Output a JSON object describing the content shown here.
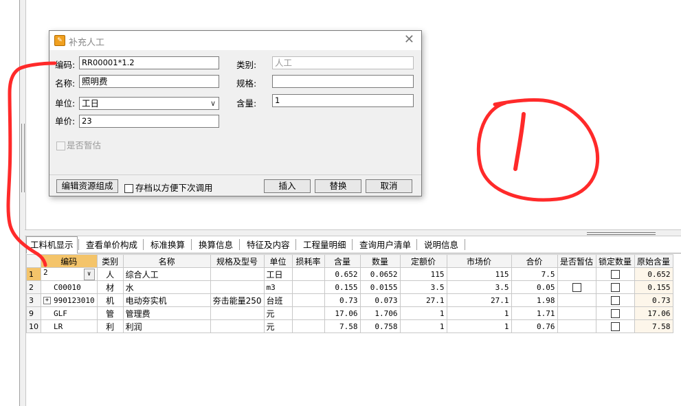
{
  "dialog": {
    "title": "补充人工",
    "icon": "app-icon",
    "close": "✕",
    "code_label": "编码:",
    "code_value": "RR00001*1.2",
    "name_label": "名称:",
    "name_value": "照明费",
    "unit_label": "单位:",
    "unit_value": "工日",
    "price_label": "单价:",
    "price_value": "23",
    "category_label": "类别:",
    "category_value": "人工",
    "spec_label": "规格:",
    "spec_value": "",
    "qty_label": "含量:",
    "qty_value": "1",
    "estimate_label": "是否暂估",
    "edit_button": "编辑资源组成",
    "save_label": "存档以方便下次调用",
    "insert_button": "插入",
    "replace_button": "替换",
    "cancel_button": "取消"
  },
  "tabs": [
    "工料机显示",
    "查看单价构成",
    "标准换算",
    "换算信息",
    "特征及内容",
    "工程量明细",
    "查询用户清单",
    "说明信息"
  ],
  "table": {
    "headers": [
      "编码",
      "类别",
      "名称",
      "规格及型号",
      "单位",
      "损耗率",
      "含量",
      "数量",
      "定额价",
      "市场价",
      "合价",
      "是否暂估",
      "锁定数量",
      "原始含量"
    ],
    "rows": [
      {
        "no": "1",
        "code": "2",
        "type": "人",
        "name": "综合人工",
        "spec": "",
        "unit": "工日",
        "loss": "",
        "qty": "0.652",
        "amount": "0.0652",
        "quota": "115",
        "market": "115",
        "total": "7.5",
        "orig": "0.652"
      },
      {
        "no": "2",
        "code": "C00010",
        "type": "材",
        "name": "水",
        "spec": "",
        "unit": "m3",
        "loss": "",
        "qty": "0.155",
        "amount": "0.0155",
        "quota": "3.5",
        "market": "3.5",
        "total": "0.05",
        "orig": "0.155"
      },
      {
        "no": "3",
        "code": "990123010",
        "type": "机",
        "name": "电动夯实机",
        "spec": "夯击能量250",
        "unit": "台班",
        "loss": "",
        "qty": "0.73",
        "amount": "0.073",
        "quota": "27.1",
        "market": "27.1",
        "total": "1.98",
        "orig": "0.73"
      },
      {
        "no": "9",
        "code": "GLF",
        "type": "管",
        "name": "管理费",
        "spec": "",
        "unit": "元",
        "loss": "",
        "qty": "17.06",
        "amount": "1.706",
        "quota": "1",
        "market": "1",
        "total": "1.71",
        "orig": "17.06"
      },
      {
        "no": "10",
        "code": "LR",
        "type": "利",
        "name": "利润",
        "spec": "",
        "unit": "元",
        "loss": "",
        "qty": "7.58",
        "amount": "0.758",
        "quota": "1",
        "market": "1",
        "total": "0.76",
        "orig": "7.58"
      }
    ]
  },
  "colors": {
    "selected_header": "#f4c46a",
    "annotation": "#ff2a2a",
    "original_col": "#fdf6ea"
  }
}
